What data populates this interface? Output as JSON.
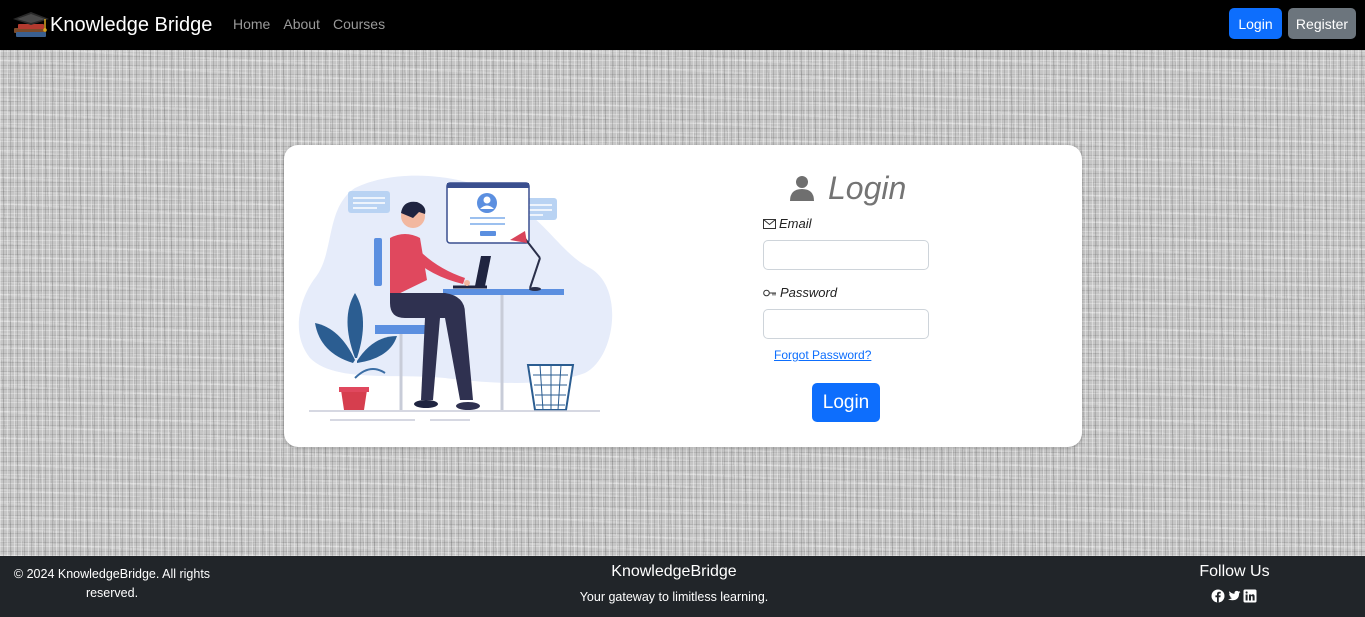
{
  "navbar": {
    "brand": "Knowledge Bridge",
    "links": [
      "Home",
      "About",
      "Courses"
    ],
    "login_label": "Login",
    "register_label": "Register"
  },
  "login_form": {
    "title": "Login",
    "email_label": "Email",
    "email_value": "",
    "password_label": "Password",
    "password_value": "",
    "forgot_password": "Forgot Password?",
    "submit_label": "Login"
  },
  "footer": {
    "copyright": "© 2024 KnowledgeBridge. All rights reserved.",
    "brand": "KnowledgeBridge",
    "tagline": "Your gateway to limitless learning.",
    "follow_title": "Follow Us",
    "social_icons": [
      "facebook-icon",
      "twitter-icon",
      "linkedin-icon"
    ]
  },
  "colors": {
    "primary": "#0d6efd",
    "secondary": "#6c757d",
    "footer_bg": "#212529",
    "navbar_bg": "#000000"
  }
}
